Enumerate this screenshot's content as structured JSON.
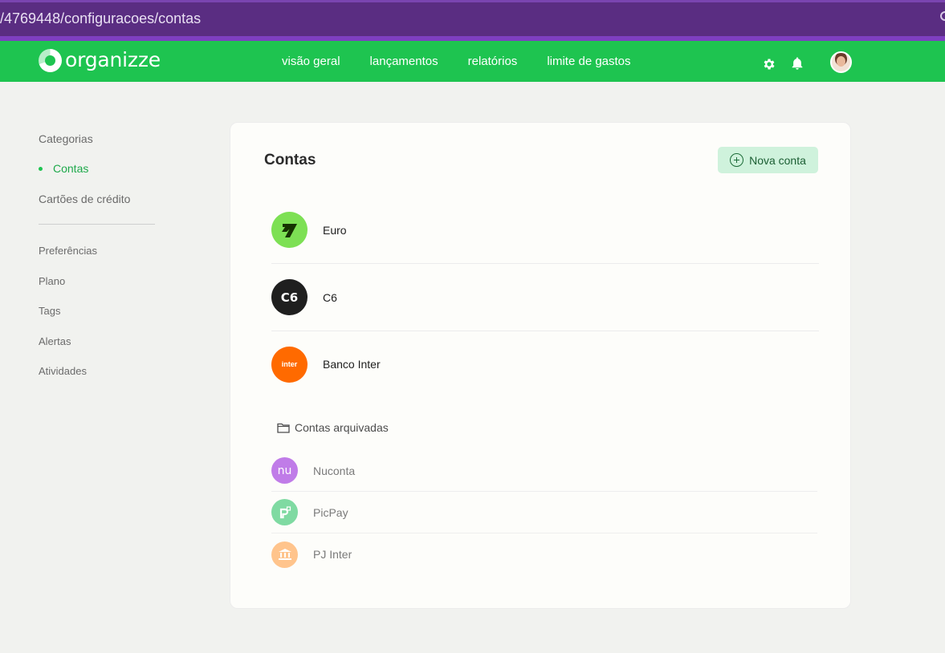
{
  "browser": {
    "url": "/4769448/configuracoes/contas"
  },
  "header": {
    "brand": "organizze",
    "menu": [
      "visão geral",
      "lançamentos",
      "relatórios",
      "limite de gastos"
    ],
    "icons": [
      "gear-icon",
      "bell-icon",
      "avatar"
    ]
  },
  "sidebar": {
    "group1": [
      "Categorias",
      "Contas",
      "Cartões de crédito"
    ],
    "active": "Contas",
    "group2": [
      "Preferências",
      "Plano",
      "Tags",
      "Alertas",
      "Atividades"
    ]
  },
  "main": {
    "title": "Contas",
    "new_button": "Nova conta",
    "accounts": [
      {
        "name": "Euro",
        "logo_color": "#7de054",
        "icon": "wise-logo-icon"
      },
      {
        "name": "C6",
        "logo_color": "#1f1f1f",
        "icon": "c6-logo-icon",
        "logo_text": "C6"
      },
      {
        "name": "Banco Inter",
        "logo_color": "#ff6a00",
        "icon": "inter-logo-icon",
        "logo_text": "inter"
      }
    ],
    "archived_label": "Contas arquivadas",
    "archived": [
      {
        "name": "Nuconta",
        "logo_color": "#c07ce8",
        "icon": "nubank-logo-icon",
        "logo_text": "nu"
      },
      {
        "name": "PicPay",
        "logo_color": "#7fdaa2",
        "icon": "picpay-logo-icon"
      },
      {
        "name": "PJ Inter",
        "logo_color": "#ffc48c",
        "icon": "bank-building-icon"
      }
    ]
  },
  "colors": {
    "brand_green": "#1ec450",
    "active_green": "#1ea94b",
    "browser_purple": "#5a2d82"
  }
}
